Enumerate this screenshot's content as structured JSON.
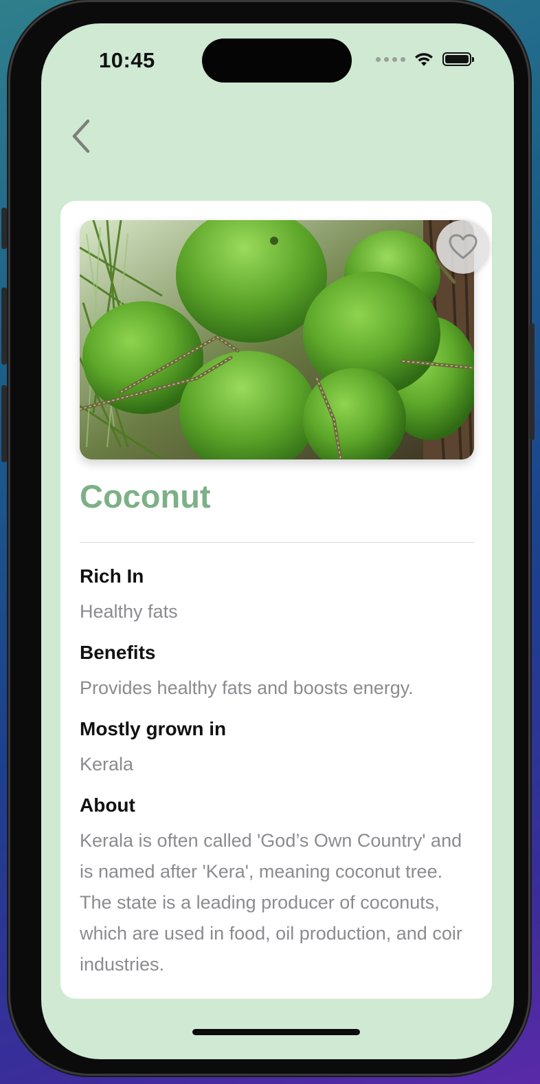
{
  "status_bar": {
    "time": "10:45"
  },
  "nav": {
    "back_icon": "chevron-left-icon"
  },
  "detail": {
    "image_subject": "green coconuts cluster",
    "favorite_icon": "heart-outline-icon",
    "title": "Coconut",
    "sections": [
      {
        "label": "Rich In",
        "value": "Healthy fats"
      },
      {
        "label": "Benefits",
        "value": "Provides healthy fats and boosts energy."
      },
      {
        "label": "Mostly grown in",
        "value": "Kerala"
      },
      {
        "label": "About",
        "value": "Kerala is often called 'God’s Own Country' and is named after 'Kera', meaning coconut tree. The state is a leading producer of coconuts, which are used in food, oil production, and coir industries."
      }
    ]
  },
  "colors": {
    "screen_background": "#cfe9d3",
    "title_green": "#7db086",
    "label_text": "#111111",
    "value_text": "#8b8b8f",
    "card_background": "#ffffff"
  }
}
